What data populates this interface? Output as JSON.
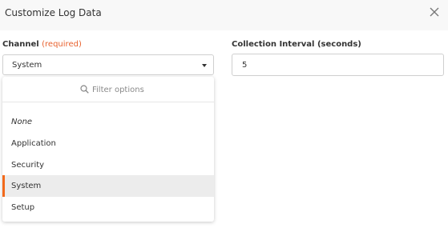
{
  "dialog": {
    "title": "Customize Log Data"
  },
  "channel": {
    "label": "Channel",
    "required_text": "(required)",
    "selected_value": "System",
    "filter_placeholder": "Filter options",
    "options": [
      "None",
      "Application",
      "Security",
      "System",
      "Setup"
    ],
    "selected_option": "System"
  },
  "collection_interval": {
    "label": "Collection Interval (seconds)",
    "value": "5"
  },
  "colors": {
    "accent": "#f26a1b",
    "required": "#e8622f",
    "header_bg": "#f8f8f8",
    "selected_bg": "#ececec"
  },
  "icons": [
    "close-icon",
    "search-icon",
    "caret-down-icon"
  ]
}
